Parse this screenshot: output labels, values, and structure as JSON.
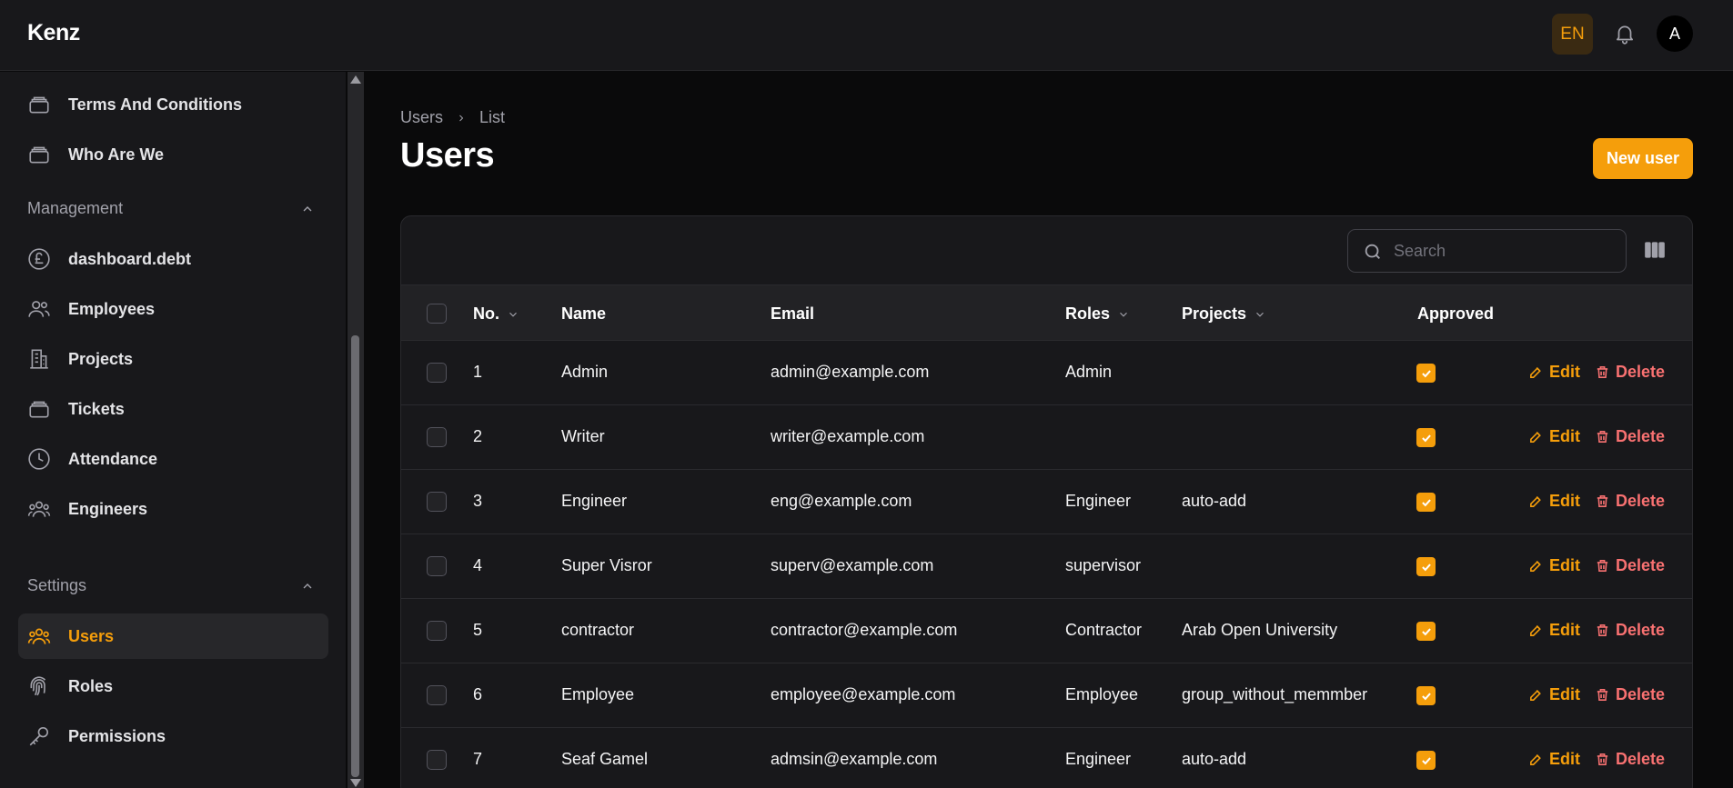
{
  "app": {
    "brand": "Kenz"
  },
  "topbar": {
    "language": "EN",
    "avatar_initial": "A"
  },
  "sidebar": {
    "top_items": [
      {
        "label": "Terms And Conditions",
        "icon": "stack-icon"
      },
      {
        "label": "Who Are We",
        "icon": "stack-icon"
      }
    ],
    "groups": [
      {
        "label": "Management",
        "items": [
          {
            "label": "dashboard.debt",
            "icon": "pound-icon"
          },
          {
            "label": "Employees",
            "icon": "users-icon"
          },
          {
            "label": "Projects",
            "icon": "building-icon"
          },
          {
            "label": "Tickets",
            "icon": "stack-icon"
          },
          {
            "label": "Attendance",
            "icon": "clock-icon"
          },
          {
            "label": "Engineers",
            "icon": "user-group-icon"
          }
        ]
      },
      {
        "label": "Settings",
        "items": [
          {
            "label": "Users",
            "icon": "user-group-icon",
            "active": true
          },
          {
            "label": "Roles",
            "icon": "fingerprint-icon"
          },
          {
            "label": "Permissions",
            "icon": "key-icon"
          }
        ]
      }
    ]
  },
  "breadcrumb": {
    "parent": "Users",
    "current": "List"
  },
  "page": {
    "title": "Users",
    "new_button": "New user"
  },
  "table": {
    "search_placeholder": "Search",
    "columns": {
      "no": "No.",
      "name": "Name",
      "email": "Email",
      "roles": "Roles",
      "projects": "Projects",
      "approved": "Approved"
    },
    "actions": {
      "edit": "Edit",
      "delete": "Delete"
    },
    "rows": [
      {
        "no": "1",
        "name": "Admin",
        "email": "admin@example.com",
        "roles": "Admin",
        "projects": "",
        "approved": true
      },
      {
        "no": "2",
        "name": "Writer",
        "email": "writer@example.com",
        "roles": "",
        "projects": "",
        "approved": true
      },
      {
        "no": "3",
        "name": "Engineer",
        "email": "eng@example.com",
        "roles": "Engineer",
        "projects": "auto-add",
        "approved": true
      },
      {
        "no": "4",
        "name": "Super Visror",
        "email": "superv@example.com",
        "roles": "supervisor",
        "projects": "",
        "approved": true
      },
      {
        "no": "5",
        "name": "contractor",
        "email": "contractor@example.com",
        "roles": "Contractor",
        "projects": "Arab Open University",
        "approved": true
      },
      {
        "no": "6",
        "name": "Employee",
        "email": "employee@example.com",
        "roles": "Employee",
        "projects": "group_without_memmber",
        "approved": true
      },
      {
        "no": "7",
        "name": "Seaf Gamel",
        "email": "admsin@example.com",
        "roles": "Engineer",
        "projects": "auto-add",
        "approved": true
      }
    ]
  },
  "colors": {
    "accent": "#f59e0b",
    "danger": "#f87171",
    "background": "#0a0a0b",
    "panel": "#18181b"
  }
}
